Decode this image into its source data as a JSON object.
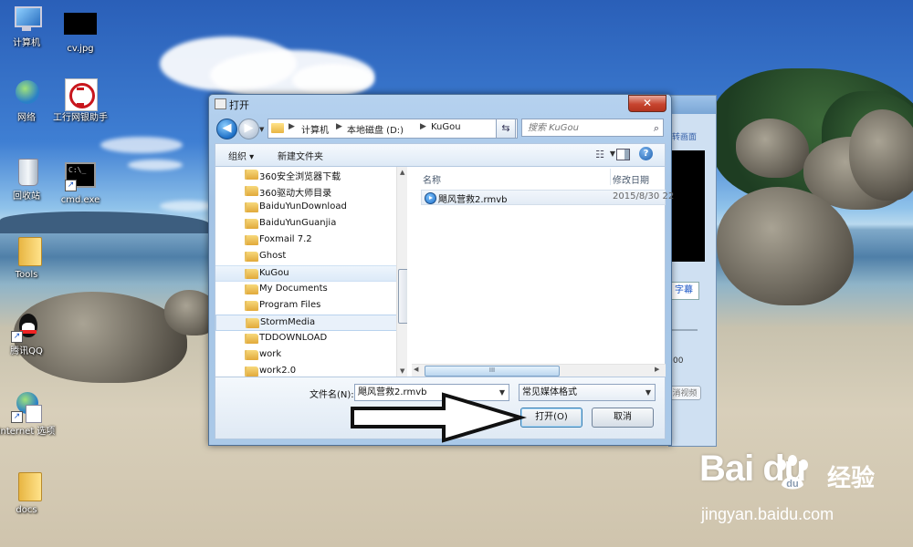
{
  "desktop": {
    "icons": [
      {
        "label": "计算机",
        "icon": "computer-icon"
      },
      {
        "label": "cv.jpg",
        "icon": "image-file-icon"
      },
      {
        "label": "网络",
        "icon": "network-icon"
      },
      {
        "label": "工行网银助手",
        "icon": "icbc-icon"
      },
      {
        "label": "回收站",
        "icon": "recycle-bin-icon"
      },
      {
        "label": "cmd.exe",
        "icon": "cmd-icon"
      },
      {
        "label": "Tools",
        "icon": "folder-icon"
      },
      {
        "label": "腾讯QQ",
        "icon": "qq-icon"
      },
      {
        "label": "Internet 选项",
        "icon": "internet-options-icon"
      },
      {
        "label": "docs",
        "icon": "folder-icon"
      }
    ]
  },
  "background_window": {
    "partial_text_1": "转画面",
    "tab_label": "字幕",
    "time_text": ":00",
    "button_label": "消视频"
  },
  "dialog": {
    "title": "打开",
    "close_glyph": "✕",
    "nav": {
      "back_glyph": "◀",
      "forward_glyph": "▶",
      "breadcrumbs": [
        "计算机",
        "本地磁盘 (D:)",
        "KuGou"
      ],
      "search_placeholder": "搜索 KuGou",
      "search_icon": "search-icon",
      "refresh_icon": "refresh-icon"
    },
    "toolbar": {
      "organize": "组织 ▾",
      "new_folder": "新建文件夹",
      "help": "?"
    },
    "tree": [
      {
        "label": "360安全浏览器下载"
      },
      {
        "label": "360驱动大师目录"
      },
      {
        "label": "BaiduYunDownload"
      },
      {
        "label": "BaiduYunGuanjia"
      },
      {
        "label": "Foxmail 7.2"
      },
      {
        "label": "Ghost"
      },
      {
        "label": "KuGou",
        "selected": true
      },
      {
        "label": "My Documents"
      },
      {
        "label": "Program Files"
      },
      {
        "label": "StormMedia",
        "hover": true
      },
      {
        "label": "TDDOWNLOAD"
      },
      {
        "label": "work"
      },
      {
        "label": "work2.0"
      }
    ],
    "files": {
      "columns": [
        "名称",
        "修改日期"
      ],
      "rows": [
        {
          "name": "飓风营救2.rmvb",
          "date": "2015/8/30 22"
        }
      ],
      "hscroll_grip": "III"
    },
    "filename_label": "文件名(N):",
    "filename_value": "飓风营救2.rmvb",
    "filter_value": "常见媒体格式",
    "open_button": "打开(O)",
    "cancel_button": "取消"
  },
  "watermark": {
    "logo": "Bai   du",
    "text": "经验",
    "url": "jingyan.baidu.com"
  }
}
